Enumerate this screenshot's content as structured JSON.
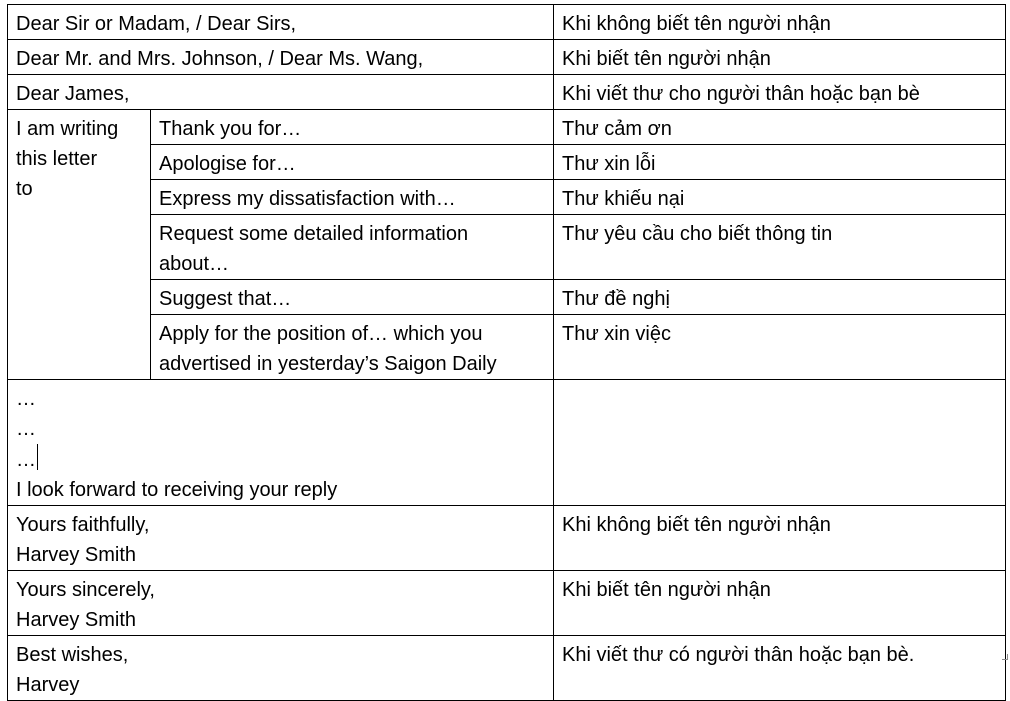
{
  "rows": {
    "dear_sir": {
      "phrase": "Dear Sir or Madam, / Dear Sirs,",
      "note": "Khi không biết tên người nhận"
    },
    "dear_mr": {
      "phrase": "Dear Mr. and Mrs. Johnson, / Dear Ms. Wang,",
      "note": "Khi biết tên người nhận"
    },
    "dear_james": {
      "phrase": "Dear James,",
      "note": "Khi viết thư cho người thân hoặc bạn bè"
    },
    "writing": {
      "lead_lines": [
        "I am writing",
        "this letter",
        "to"
      ],
      "items": [
        {
          "lines": [
            "Thank you for…"
          ],
          "note": "Thư cảm ơn"
        },
        {
          "lines": [
            "Apologise for…"
          ],
          "note": "Thư xin lỗi"
        },
        {
          "lines": [
            "Express my dissatisfaction with…"
          ],
          "note": "Thư khiếu nại"
        },
        {
          "lines": [
            "Request some detailed information",
            "about…"
          ],
          "note": "Thư yêu cầu cho biết thông tin"
        },
        {
          "lines": [
            "Suggest that…"
          ],
          "note": "Thư đề nghị"
        },
        {
          "lines": [
            "Apply for the position of… which you",
            "advertised in yesterday’s Saigon Daily"
          ],
          "note": "Thư xin việc"
        }
      ]
    },
    "body": {
      "lines": [
        "…",
        "…",
        "…",
        "I look forward to receiving your reply"
      ],
      "note": ""
    },
    "closing_faithfully": {
      "lines": [
        "Yours faithfully,",
        "Harvey Smith"
      ],
      "note": "Khi không biết tên người nhận"
    },
    "closing_sincerely": {
      "lines": [
        "Yours sincerely,",
        "Harvey Smith"
      ],
      "note": "Khi biết tên người nhận"
    },
    "closing_best": {
      "lines": [
        "Best wishes,",
        "Harvey"
      ],
      "note": "Khi viết thư có người thân hoặc bạn bè."
    }
  }
}
